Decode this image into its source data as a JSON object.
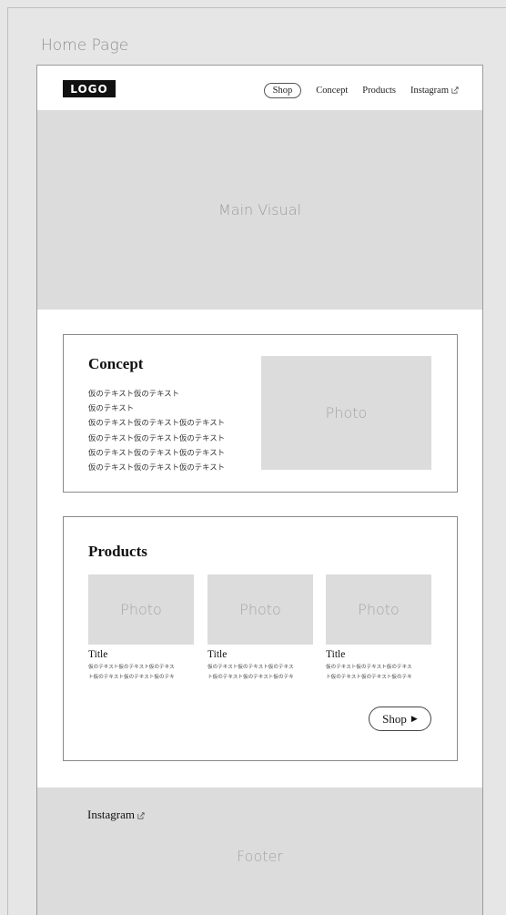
{
  "frame": {
    "label": "Home Page"
  },
  "header": {
    "logo": "LOGO",
    "nav": {
      "shop": "Shop",
      "concept": "Concept",
      "products": "Products",
      "instagram": "Instagram",
      "instagram_icon": "external-link-icon"
    }
  },
  "main_visual": {
    "label": "Main Visual"
  },
  "concept": {
    "title": "Concept",
    "lines": [
      "仮のテキスト仮のテキスト",
      "仮のテキスト",
      "仮のテキスト仮のテキスト仮のテキスト",
      "仮のテキスト仮のテキスト仮のテキスト",
      "仮のテキスト仮のテキスト仮のテキスト",
      "仮のテキスト仮のテキスト仮のテキスト"
    ],
    "photo_label": "Photo"
  },
  "products": {
    "title": "Products",
    "items": [
      {
        "photo_label": "Photo",
        "title": "Title",
        "desc_line1": "仮のテキスト仮のテキスト仮のテキス",
        "desc_line2": "ト仮のテキスト仮のテキスト仮のテキ"
      },
      {
        "photo_label": "Photo",
        "title": "Title",
        "desc_line1": "仮のテキスト仮のテキスト仮のテキス",
        "desc_line2": "ト仮のテキスト仮のテキスト仮のテキ"
      },
      {
        "photo_label": "Photo",
        "title": "Title",
        "desc_line1": "仮のテキスト仮のテキスト仮のテキス",
        "desc_line2": "ト仮のテキスト仮のテキスト仮のテキ"
      }
    ],
    "shop_button": "Shop",
    "shop_arrow": "▶"
  },
  "footer": {
    "instagram": "Instagram",
    "label": "Footer"
  },
  "colors": {
    "background": "#e6e6e6",
    "placeholder_gray": "#dcdcdc",
    "logo_black": "#111111"
  }
}
